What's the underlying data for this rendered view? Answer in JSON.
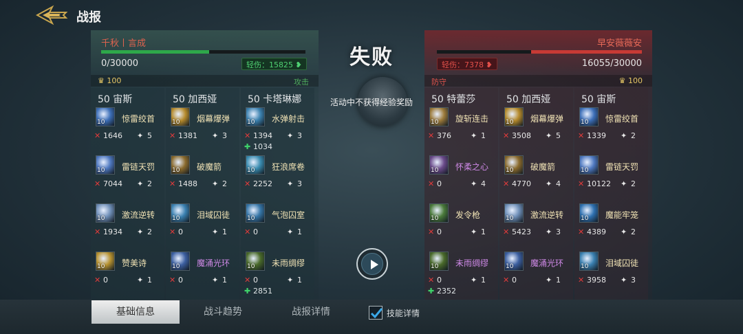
{
  "header": {
    "title": "战报"
  },
  "result": {
    "text": "失败",
    "notice": "活动中不获得经验奖励"
  },
  "left": {
    "name": "千秋丨言成",
    "hp_fraction": 0.53,
    "hp_text": "0/30000",
    "injury_text": "轻伤：15825",
    "coins": "100",
    "role": "攻击",
    "heroes": [
      {
        "name": "50 宙斯",
        "skills": [
          {
            "name": "惊雷绞首",
            "level": "10",
            "dmg": "1646",
            "count": "5",
            "purple": false,
            "icon": "lightning-icon",
            "color": "#3d6fb8"
          },
          {
            "name": "雷链天罚",
            "level": "10",
            "dmg": "7044",
            "count": "2",
            "purple": false,
            "icon": "lightning-chain-icon",
            "color": "#4e78c0"
          },
          {
            "name": "激流逆转",
            "level": "10",
            "dmg": "1934",
            "count": "2",
            "purple": false,
            "icon": "current-icon",
            "color": "#6f8fb8"
          },
          {
            "name": "赞美诗",
            "level": "10",
            "dmg": "0",
            "count": "1",
            "purple": false,
            "icon": "hymn-icon",
            "color": "#b79230"
          }
        ]
      },
      {
        "name": "50 加西娅",
        "skills": [
          {
            "name": "烟幕爆弹",
            "level": "10",
            "dmg": "1381",
            "count": "3",
            "purple": false,
            "icon": "smoke-bomb-icon",
            "color": "#b58a2c"
          },
          {
            "name": "破魔箭",
            "level": "10",
            "dmg": "1488",
            "count": "2",
            "purple": false,
            "icon": "arrow-icon",
            "color": "#8a6a2c"
          },
          {
            "name": "泪域囚徒",
            "level": "10",
            "dmg": "0",
            "count": "1",
            "purple": false,
            "icon": "tear-prison-icon",
            "color": "#3a80b0"
          },
          {
            "name": "魔涌光环",
            "level": "10",
            "dmg": "0",
            "count": "1",
            "purple": true,
            "icon": "magic-aura-icon",
            "color": "#3c5fa0"
          }
        ]
      },
      {
        "name": "50 卡塔琳娜",
        "heal_idx": 0,
        "skills": [
          {
            "name": "水弹射击",
            "level": "10",
            "dmg": "1394",
            "count": "3",
            "purple": false,
            "heal": "1034",
            "icon": "water-shot-icon",
            "color": "#3c82b0"
          },
          {
            "name": "狂浪席卷",
            "level": "10",
            "dmg": "2252",
            "count": "3",
            "purple": false,
            "icon": "wave-icon",
            "color": "#3a8cb0"
          },
          {
            "name": "气泡囚室",
            "level": "10",
            "dmg": "0",
            "count": "1",
            "purple": false,
            "icon": "bubble-icon",
            "color": "#3676a8"
          },
          {
            "name": "未雨绸缪",
            "level": "10",
            "dmg": "0",
            "count": "1",
            "purple": false,
            "heal": "2851",
            "icon": "eye-icon",
            "color": "#4a6a2a"
          }
        ]
      }
    ]
  },
  "right": {
    "name": "早安薇薇安",
    "hp_fraction": 0.54,
    "hp_text": "16055/30000",
    "injury_text": "轻伤：7378",
    "coins": "100",
    "role": "防守",
    "heroes": [
      {
        "name": "50 特蕾莎",
        "skills": [
          {
            "name": "旋斩连击",
            "level": "10",
            "dmg": "376",
            "count": "1",
            "purple": false,
            "icon": "spin-slash-icon",
            "color": "#9c7a3a"
          },
          {
            "name": "怀柔之心",
            "level": "10",
            "dmg": "0",
            "count": "4",
            "purple": true,
            "icon": "heart-icon",
            "color": "#6a4a8a"
          },
          {
            "name": "发令枪",
            "level": "10",
            "dmg": "0",
            "count": "1",
            "purple": false,
            "icon": "spear-icon",
            "color": "#4a7a3a"
          },
          {
            "name": "未雨绸缪",
            "level": "10",
            "dmg": "0",
            "count": "1",
            "purple": true,
            "heal": "2352",
            "icon": "eye-icon",
            "color": "#4a6a2a"
          }
        ]
      },
      {
        "name": "50 加西娅",
        "skills": [
          {
            "name": "烟幕爆弹",
            "level": "10",
            "dmg": "3508",
            "count": "5",
            "purple": false,
            "icon": "smoke-bomb-icon",
            "color": "#b58a2c"
          },
          {
            "name": "破魔箭",
            "level": "10",
            "dmg": "4770",
            "count": "4",
            "purple": false,
            "icon": "arrow-icon",
            "color": "#8a6a2c"
          },
          {
            "name": "激流逆转",
            "level": "10",
            "dmg": "5423",
            "count": "3",
            "purple": false,
            "icon": "current-icon",
            "color": "#6f8fb8"
          },
          {
            "name": "魔涌光环",
            "level": "10",
            "dmg": "0",
            "count": "1",
            "purple": true,
            "icon": "magic-aura-icon",
            "color": "#3c5fa0"
          }
        ]
      },
      {
        "name": "50 宙斯",
        "skills": [
          {
            "name": "惊雷绞首",
            "level": "10",
            "dmg": "1339",
            "count": "2",
            "purple": false,
            "icon": "lightning-icon",
            "color": "#3d6fb8"
          },
          {
            "name": "雷链天罚",
            "level": "10",
            "dmg": "10122",
            "count": "2",
            "purple": false,
            "icon": "lightning-chain-icon",
            "color": "#4e78c0"
          },
          {
            "name": "魔能牢笼",
            "level": "10",
            "dmg": "4389",
            "count": "2",
            "purple": false,
            "icon": "magic-cage-icon",
            "color": "#2e70b0"
          },
          {
            "name": "泪域囚徒",
            "level": "10",
            "dmg": "3958",
            "count": "3",
            "purple": false,
            "icon": "tear-prison-icon",
            "color": "#3a80b0"
          }
        ]
      }
    ]
  },
  "tabs": [
    {
      "label": "基础信息"
    },
    {
      "label": "战斗趋势"
    },
    {
      "label": "战报详情"
    }
  ],
  "checkbox": {
    "label": "技能详情",
    "checked": true
  }
}
